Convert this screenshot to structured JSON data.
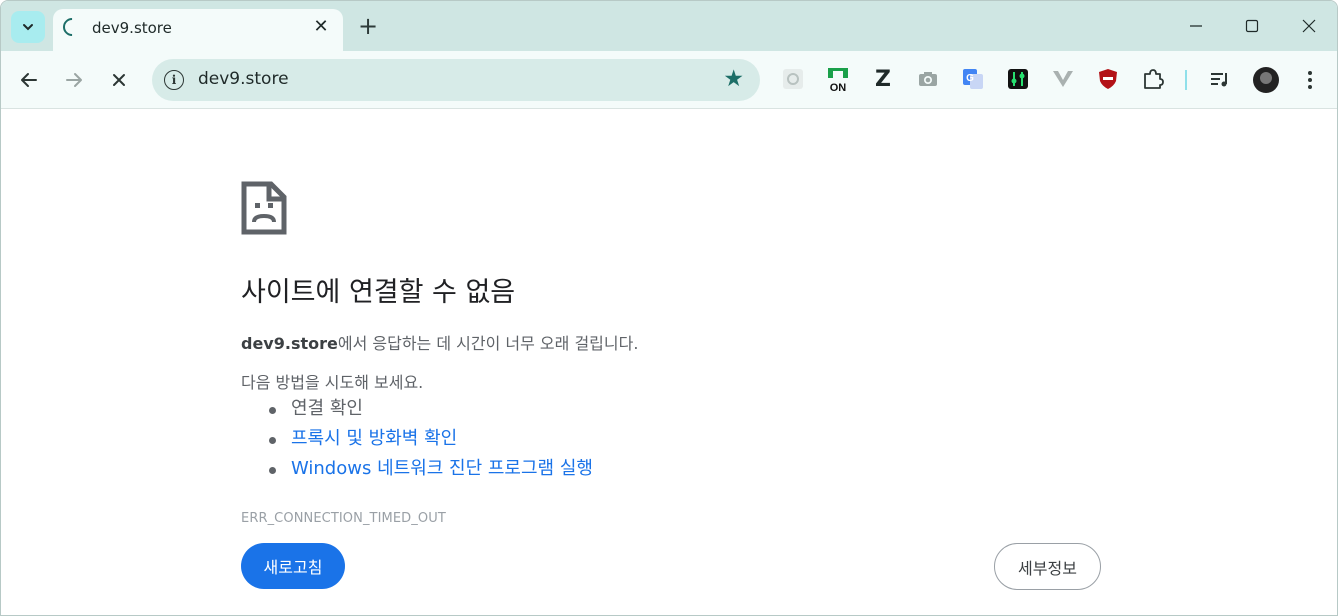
{
  "browser": {
    "tab": {
      "title": "dev9.store"
    },
    "new_tab_symbol": "+",
    "omnibox": {
      "url": "dev9.store"
    },
    "extensions": [
      {
        "icon": "settings-gear-extension-icon"
      },
      {
        "icon": "on-badge-extension-icon",
        "text": "ON"
      },
      {
        "icon": "z-extension-icon",
        "text": "Z"
      },
      {
        "icon": "camera-extension-icon"
      },
      {
        "icon": "google-translate-extension-icon"
      },
      {
        "icon": "equalizer-extension-icon"
      },
      {
        "icon": "v-extension-icon"
      },
      {
        "icon": "shield-block-extension-icon"
      },
      {
        "icon": "puzzle-extensions-icon"
      },
      {
        "icon": "media-queue-icon"
      }
    ],
    "colors": {
      "tabstrip": "#cfe6e3",
      "toolbar": "#f4fbfa",
      "accent": "#1c6e67"
    }
  },
  "error_page": {
    "heading": "사이트에 연결할 수 없음",
    "host": "dev9.store",
    "description_suffix": "에서 응답하는 데 시간이 너무 오래 걸립니다.",
    "try_text": "다음 방법을 시도해 보세요.",
    "suggestions": [
      {
        "text": "연결 확인",
        "link": false
      },
      {
        "text": "프록시 및 방화벽 확인",
        "link": true
      },
      {
        "text": "Windows 네트워크 진단 프로그램 실행",
        "link": true
      }
    ],
    "error_code": "ERR_CONNECTION_TIMED_OUT",
    "reload_label": "새로고침",
    "details_label": "세부정보",
    "colors": {
      "primary": "#1a73e8",
      "text": "#5f6368",
      "heading": "#202124"
    }
  }
}
